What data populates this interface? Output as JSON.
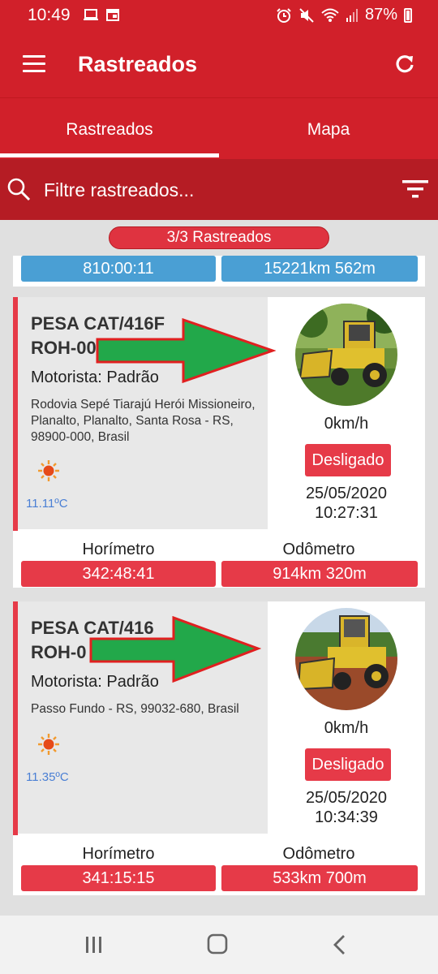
{
  "status_bar": {
    "time": "10:49",
    "battery": "87%"
  },
  "app_bar": {
    "title": "Rastreados",
    "menu_icon": "hamburger-menu-icon",
    "refresh_icon": "refresh-icon"
  },
  "tabs": [
    {
      "label": "Rastreados",
      "active": true
    },
    {
      "label": "Mapa",
      "active": false
    }
  ],
  "search": {
    "placeholder": "Filtre rastreados...",
    "value": ""
  },
  "count_label": "3/3 Rastreados",
  "partial_card": {
    "hourmeter": "810:00:11",
    "odometer": "15221km 562m"
  },
  "vehicles": [
    {
      "name_line1": "PESA CAT/416F",
      "name_line2": "ROH-00",
      "driver": "Motorista: Padrão",
      "address": "Rodovia Sepé Tiarajú Herói Missioneiro, Planalto, Planalto, Santa Rosa - RS, 98900-000, Brasil",
      "temperature": "11.11ºC",
      "speed": "0km/h",
      "status": "Desligado",
      "date": "25/05/2020",
      "time": "10:27:31",
      "hourmeter_label": "Horímetro",
      "hourmeter": "342:48:41",
      "odometer_label": "Odômetro",
      "odometer": "914km 320m"
    },
    {
      "name_line1": "PESA CAT/416",
      "name_line2": "ROH-0",
      "driver": "Motorista: Padrão",
      "address": "Passo Fundo - RS, 99032-680, Brasil",
      "temperature": "11.35ºC",
      "speed": "0km/h",
      "status": "Desligado",
      "date": "25/05/2020",
      "time": "10:34:39",
      "hourmeter_label": "Horímetro",
      "hourmeter": "341:15:15",
      "odometer_label": "Odômetro",
      "odometer": "533km 700m"
    }
  ],
  "colors": {
    "primary": "#d1202a",
    "accent_red": "#e63a48",
    "blue": "#4a9fd4",
    "arrow_green": "#22a84a",
    "arrow_border": "#e02020"
  }
}
